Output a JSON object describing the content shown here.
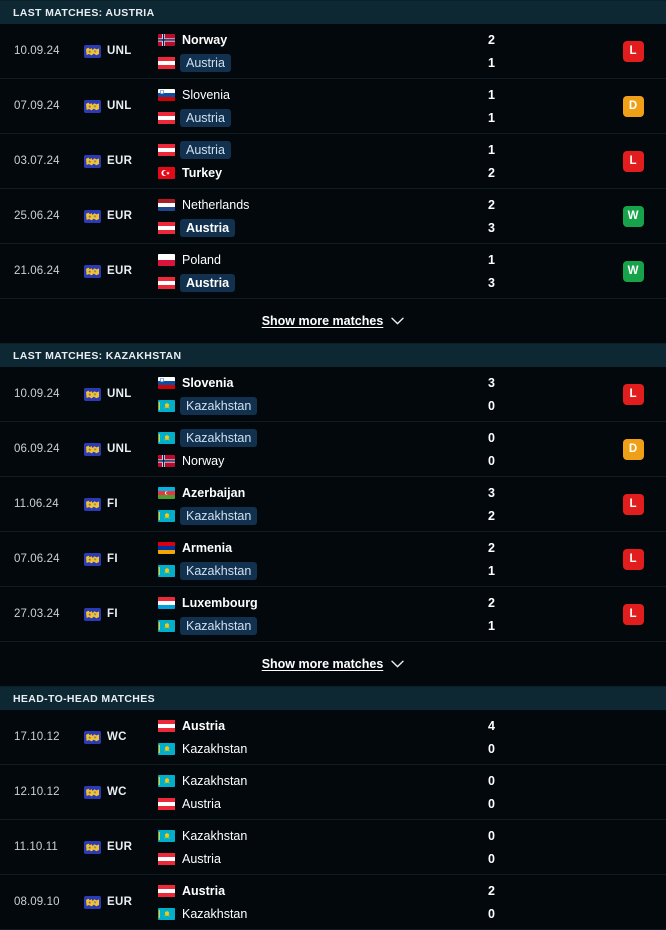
{
  "colors": {
    "page_bg": "#03080c",
    "section_header_bg": "#0d2832",
    "win": "#16a34a",
    "loss": "#e11d1d",
    "draw": "#f0a017",
    "highlight_pill": "#12314e"
  },
  "sections": [
    {
      "id": "last-matches-austria",
      "title": "LAST MATCHES: AUSTRIA",
      "show_more": {
        "label": "Show more matches",
        "icon": "chevron-down-icon"
      },
      "matches": [
        {
          "date": "10.09.24",
          "competition": {
            "code": "UNL",
            "icon": "uefa-nations-league-icon"
          },
          "home": {
            "name": "Norway",
            "flag": "norway",
            "bold": true,
            "highlight": false
          },
          "away": {
            "name": "Austria",
            "flag": "austria",
            "bold": false,
            "highlight": true
          },
          "home_score": "2",
          "away_score": "1",
          "result": "L"
        },
        {
          "date": "07.09.24",
          "competition": {
            "code": "UNL",
            "icon": "uefa-nations-league-icon"
          },
          "home": {
            "name": "Slovenia",
            "flag": "slovenia",
            "bold": false,
            "highlight": false
          },
          "away": {
            "name": "Austria",
            "flag": "austria",
            "bold": false,
            "highlight": true
          },
          "home_score": "1",
          "away_score": "1",
          "result": "D"
        },
        {
          "date": "03.07.24",
          "competition": {
            "code": "EUR",
            "icon": "uefa-euro-icon"
          },
          "home": {
            "name": "Austria",
            "flag": "austria",
            "bold": false,
            "highlight": true
          },
          "away": {
            "name": "Turkey",
            "flag": "turkey",
            "bold": true,
            "highlight": false
          },
          "home_score": "1",
          "away_score": "2",
          "result": "L"
        },
        {
          "date": "25.06.24",
          "competition": {
            "code": "EUR",
            "icon": "uefa-euro-icon"
          },
          "home": {
            "name": "Netherlands",
            "flag": "netherlands",
            "bold": false,
            "highlight": false
          },
          "away": {
            "name": "Austria",
            "flag": "austria",
            "bold": true,
            "highlight": true
          },
          "home_score": "2",
          "away_score": "3",
          "result": "W"
        },
        {
          "date": "21.06.24",
          "competition": {
            "code": "EUR",
            "icon": "uefa-euro-icon"
          },
          "home": {
            "name": "Poland",
            "flag": "poland",
            "bold": false,
            "highlight": false
          },
          "away": {
            "name": "Austria",
            "flag": "austria",
            "bold": true,
            "highlight": true
          },
          "home_score": "1",
          "away_score": "3",
          "result": "W"
        }
      ]
    },
    {
      "id": "last-matches-kazakhstan",
      "title": "LAST MATCHES: KAZAKHSTAN",
      "show_more": {
        "label": "Show more matches",
        "icon": "chevron-down-icon"
      },
      "matches": [
        {
          "date": "10.09.24",
          "competition": {
            "code": "UNL",
            "icon": "uefa-nations-league-icon"
          },
          "home": {
            "name": "Slovenia",
            "flag": "slovenia",
            "bold": true,
            "highlight": false
          },
          "away": {
            "name": "Kazakhstan",
            "flag": "kazakhstan",
            "bold": false,
            "highlight": true
          },
          "home_score": "3",
          "away_score": "0",
          "result": "L"
        },
        {
          "date": "06.09.24",
          "competition": {
            "code": "UNL",
            "icon": "uefa-nations-league-icon"
          },
          "home": {
            "name": "Kazakhstan",
            "flag": "kazakhstan",
            "bold": false,
            "highlight": true
          },
          "away": {
            "name": "Norway",
            "flag": "norway",
            "bold": false,
            "highlight": false
          },
          "home_score": "0",
          "away_score": "0",
          "result": "D"
        },
        {
          "date": "11.06.24",
          "competition": {
            "code": "FI",
            "icon": "friendly-international-icon"
          },
          "home": {
            "name": "Azerbaijan",
            "flag": "azerbaijan",
            "bold": true,
            "highlight": false
          },
          "away": {
            "name": "Kazakhstan",
            "flag": "kazakhstan",
            "bold": false,
            "highlight": true
          },
          "home_score": "3",
          "away_score": "2",
          "result": "L"
        },
        {
          "date": "07.06.24",
          "competition": {
            "code": "FI",
            "icon": "friendly-international-icon"
          },
          "home": {
            "name": "Armenia",
            "flag": "armenia",
            "bold": true,
            "highlight": false
          },
          "away": {
            "name": "Kazakhstan",
            "flag": "kazakhstan",
            "bold": false,
            "highlight": true
          },
          "home_score": "2",
          "away_score": "1",
          "result": "L"
        },
        {
          "date": "27.03.24",
          "competition": {
            "code": "FI",
            "icon": "friendly-international-icon"
          },
          "home": {
            "name": "Luxembourg",
            "flag": "luxembourg",
            "bold": true,
            "highlight": false
          },
          "away": {
            "name": "Kazakhstan",
            "flag": "kazakhstan",
            "bold": false,
            "highlight": true
          },
          "home_score": "2",
          "away_score": "1",
          "result": "L"
        }
      ]
    },
    {
      "id": "head-to-head-matches",
      "title": "HEAD-TO-HEAD MATCHES",
      "show_more": null,
      "matches": [
        {
          "date": "17.10.12",
          "competition": {
            "code": "WC",
            "icon": "world-cup-qualification-icon"
          },
          "home": {
            "name": "Austria",
            "flag": "austria",
            "bold": true,
            "highlight": false
          },
          "away": {
            "name": "Kazakhstan",
            "flag": "kazakhstan",
            "bold": false,
            "highlight": false
          },
          "home_score": "4",
          "away_score": "0",
          "result": null
        },
        {
          "date": "12.10.12",
          "competition": {
            "code": "WC",
            "icon": "world-cup-qualification-icon"
          },
          "home": {
            "name": "Kazakhstan",
            "flag": "kazakhstan",
            "bold": false,
            "highlight": false
          },
          "away": {
            "name": "Austria",
            "flag": "austria",
            "bold": false,
            "highlight": false
          },
          "home_score": "0",
          "away_score": "0",
          "result": null
        },
        {
          "date": "11.10.11",
          "competition": {
            "code": "EUR",
            "icon": "uefa-euro-icon"
          },
          "home": {
            "name": "Kazakhstan",
            "flag": "kazakhstan",
            "bold": false,
            "highlight": false
          },
          "away": {
            "name": "Austria",
            "flag": "austria",
            "bold": false,
            "highlight": false
          },
          "home_score": "0",
          "away_score": "0",
          "result": null
        },
        {
          "date": "08.09.10",
          "competition": {
            "code": "EUR",
            "icon": "uefa-euro-icon"
          },
          "home": {
            "name": "Austria",
            "flag": "austria",
            "bold": true,
            "highlight": false
          },
          "away": {
            "name": "Kazakhstan",
            "flag": "kazakhstan",
            "bold": false,
            "highlight": false
          },
          "home_score": "2",
          "away_score": "0",
          "result": null
        }
      ]
    }
  ]
}
